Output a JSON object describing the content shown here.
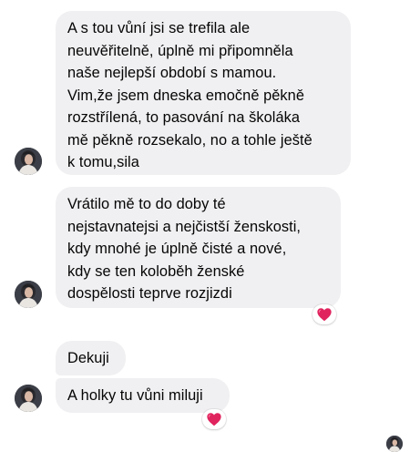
{
  "messages": [
    {
      "lines": [
        "A s tou vůní jsi se trefila ale",
        "neuvěřitelně, úplně mi připomněla",
        "naše nejlepší období s mamou.",
        "Vim,že jsem dneska emočně pěkně",
        "rozstřílená, to pasování na školáka",
        "mě pěkně rozsekalo, no a tohle ještě",
        "k tomu,sila"
      ]
    },
    {
      "lines": [
        "Vrátilo mě to do doby té",
        "nejstavnatejsi a nejčistší ženskosti,",
        "kdy mnohé je úplně čisté a nové,",
        "kdy se ten koloběh ženské",
        "dospělosti teprve rozjizdi"
      ],
      "reaction": "heart-icon"
    },
    {
      "lines": [
        "Dekuji"
      ]
    },
    {
      "lines": [
        "A holky tu vůni miluji"
      ],
      "reaction": "heart-icon"
    }
  ],
  "colors": {
    "bubble": "#f0f0f2",
    "text": "#050505",
    "heart": "#e0245e"
  }
}
